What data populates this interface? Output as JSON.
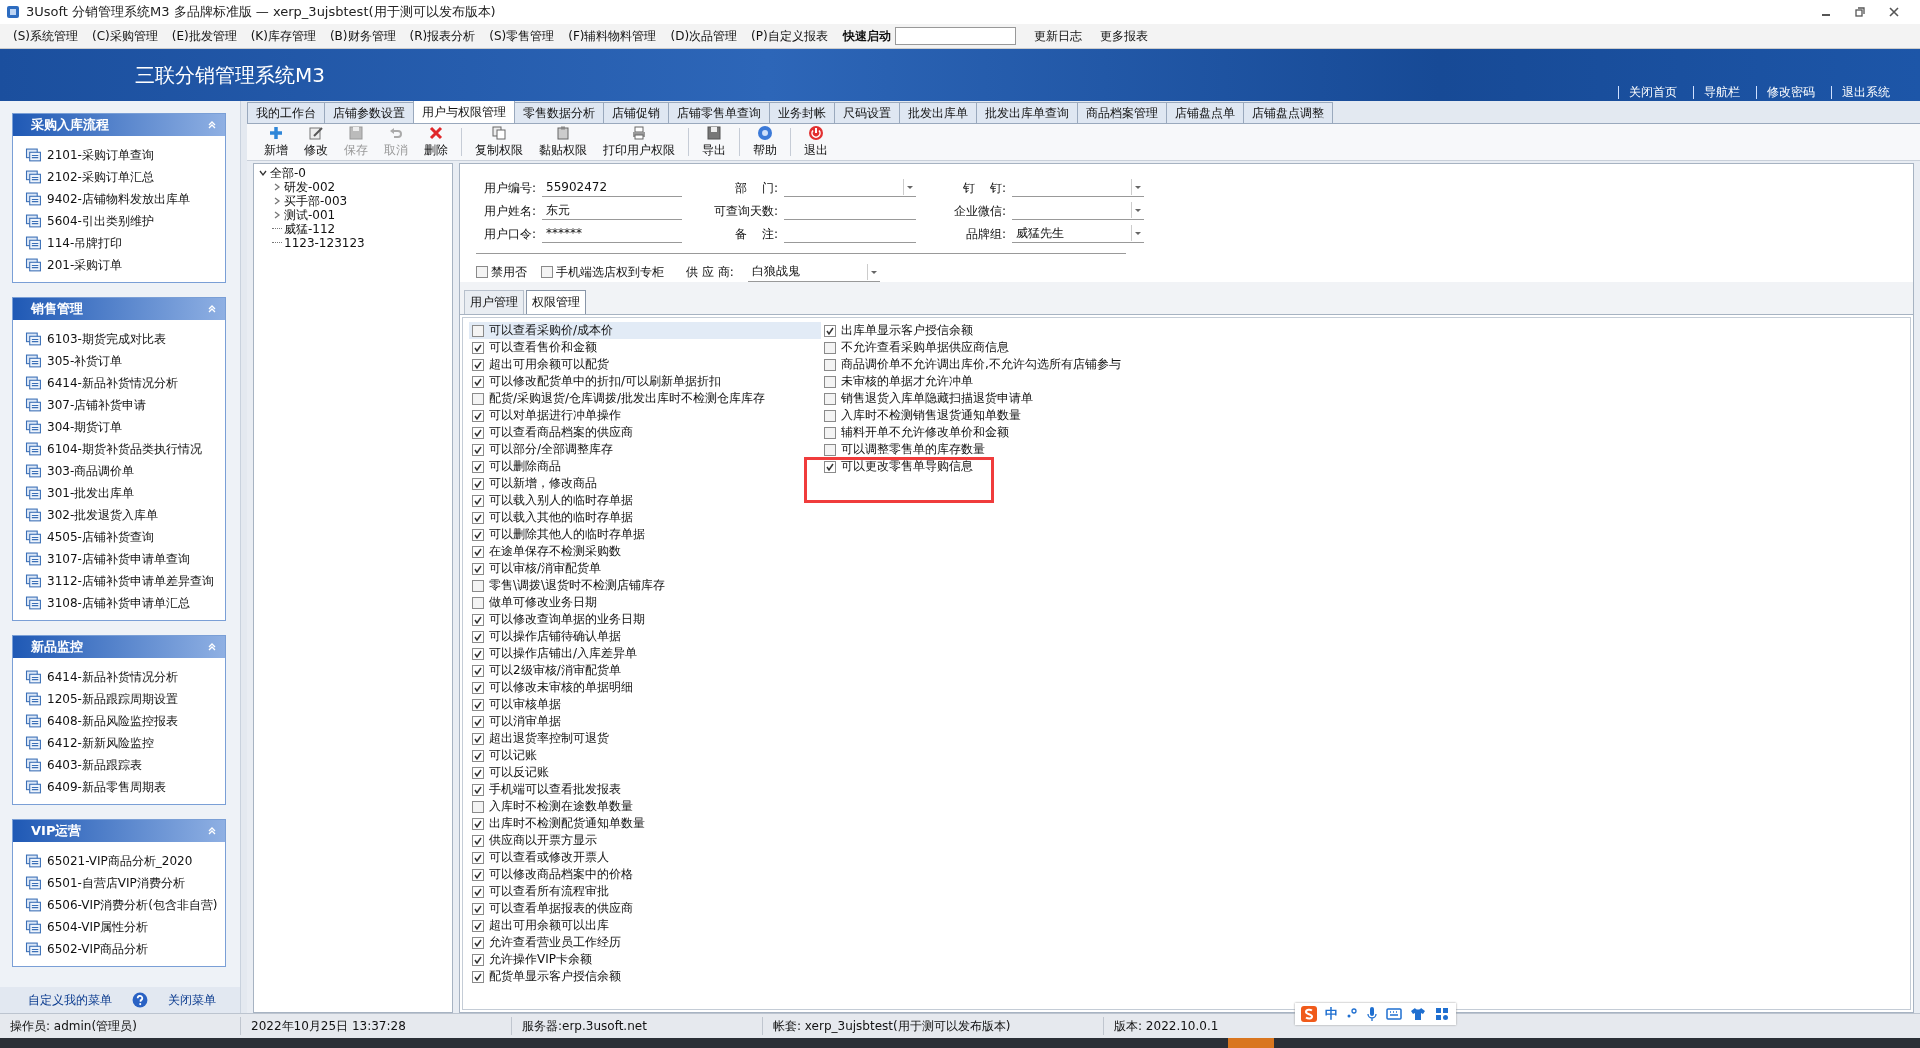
{
  "window": {
    "title": "3Usoft 分销管理系统M3 多品牌标准版 — xerp_3ujsbtest(用于测可以发布版本)"
  },
  "menu_bar": {
    "items": [
      "(S)系统管理",
      "(C)采购管理",
      "(E)批发管理",
      "(K)库存管理",
      "(B)财务管理",
      "(R)报表分析",
      "(S)零售管理",
      "(F)辅料物料管理",
      "(D)次品管理",
      "(P)自定义报表"
    ],
    "quick_launch": {
      "label": "快速启动"
    },
    "links": [
      "更新日志",
      "更多报表"
    ]
  },
  "banner": {
    "title": "三联分销管理系统M3",
    "links": [
      "关闭首页",
      "导航栏",
      "修改密码",
      "退出系统"
    ]
  },
  "sidebar": {
    "groups": [
      {
        "title": "采购入库流程",
        "expanded": true,
        "items": [
          "2101-采购订单查询",
          "2102-采购订单汇总",
          "9402-店铺物料发放出库单",
          "5604-引出类别维护",
          "114-吊牌打印",
          "201-采购订单"
        ]
      },
      {
        "title": "销售管理",
        "expanded": true,
        "items": [
          "6103-期货完成对比表",
          "305-补货订单",
          "6414-新品补货情况分析",
          "307-店铺补货申请",
          "304-期货订单",
          "6104-期货补货品类执行情况",
          "303-商品调价单",
          "301-批发出库单",
          "302-批发退货入库单",
          "4505-店铺补货查询",
          "3107-店铺补货申请单查询",
          "3112-店铺补货申请单差异查询",
          "3108-店铺补货申请单汇总"
        ]
      },
      {
        "title": "新品监控",
        "expanded": true,
        "items": [
          "6414-新品补货情况分析",
          "1205-新品跟踪周期设置",
          "6408-新品风险监控报表",
          "6412-新新风险监控",
          "6403-新品跟踪表",
          "6409-新品零售周期表"
        ]
      },
      {
        "title": "VIP运营",
        "expanded": true,
        "items": [
          "65021-VIP商品分析_2020",
          "6501-自营店VIP消费分析",
          "6506-VIP消费分析(包含非自营)",
          "6504-VIP属性分析",
          "6502-VIP商品分析"
        ]
      }
    ],
    "footer": {
      "customize": "自定义我的菜单",
      "close": "关闭菜单"
    }
  },
  "tabs": [
    {
      "label": "我的工作台",
      "selected": false
    },
    {
      "label": "店铺参数设置",
      "selected": false
    },
    {
      "label": "用户与权限管理",
      "selected": true
    },
    {
      "label": "零售数据分析",
      "selected": false
    },
    {
      "label": "店铺促销",
      "selected": false
    },
    {
      "label": "店铺零售单查询",
      "selected": false
    },
    {
      "label": "业务封帐",
      "selected": false
    },
    {
      "label": "尺码设置",
      "selected": false
    },
    {
      "label": "批发出库单",
      "selected": false
    },
    {
      "label": "批发出库单查询",
      "selected": false
    },
    {
      "label": "商品档案管理",
      "selected": false
    },
    {
      "label": "店铺盘点单",
      "selected": false
    },
    {
      "label": "店铺盘点调整",
      "selected": false
    }
  ],
  "toolbar": [
    {
      "label": "新增",
      "kind": "add",
      "disabled": false,
      "separator_before": false
    },
    {
      "label": "修改",
      "kind": "edit",
      "disabled": false,
      "separator_before": false
    },
    {
      "label": "保存",
      "kind": "save",
      "disabled": true,
      "separator_before": false
    },
    {
      "label": "取消",
      "kind": "undo",
      "disabled": true,
      "separator_before": false
    },
    {
      "label": "删除",
      "kind": "delete",
      "disabled": false,
      "separator_before": false
    },
    {
      "label": "复制权限",
      "kind": "copy",
      "disabled": false,
      "separator_before": true
    },
    {
      "label": "黏贴权限",
      "kind": "paste",
      "disabled": false,
      "separator_before": false
    },
    {
      "label": "打印用户权限",
      "kind": "print",
      "disabled": false,
      "separator_before": false
    },
    {
      "label": "导出",
      "kind": "export",
      "disabled": false,
      "separator_before": true
    },
    {
      "label": "帮助",
      "kind": "help",
      "disabled": false,
      "separator_before": true
    },
    {
      "label": "退出",
      "kind": "exit",
      "disabled": false,
      "separator_before": true
    }
  ],
  "tree": {
    "label": "全部-0",
    "expanded": true,
    "children": [
      {
        "label": "研发-002",
        "expandable": true
      },
      {
        "label": "买手部-003",
        "expandable": true
      },
      {
        "label": "测试-001",
        "expandable": true
      },
      {
        "label": "威猛-112",
        "expandable": false
      },
      {
        "label": "1123-123123",
        "expandable": false
      }
    ]
  },
  "form": {
    "rows": [
      [
        {
          "label": "用户编号:",
          "kind": "text",
          "value": "55902472"
        },
        {
          "label": "部    门:",
          "kind": "dropdown"
        },
        {
          "label": "钉    钉:",
          "kind": "dropdown"
        }
      ],
      [
        {
          "label": "用户姓名:",
          "kind": "text",
          "value": "东元"
        },
        {
          "label": "可查询天数:",
          "kind": "text"
        },
        {
          "label": "企业微信:",
          "kind": "dropdown"
        }
      ],
      [
        {
          "label": "用户口令:",
          "kind": "text",
          "value": "******"
        },
        {
          "label": "备    注:",
          "kind": "text"
        },
        {
          "label": "品牌组:",
          "kind": "dropdown",
          "value": "威猛先生"
        }
      ]
    ],
    "options": [
      {
        "label": "禁用否",
        "checked": false
      },
      {
        "label": "手机端选店权到专柜",
        "checked": false
      }
    ],
    "supplier": {
      "label": "供 应 商:",
      "value": "白狼战鬼"
    }
  },
  "permissions": {
    "tabs": [
      {
        "label": "用户管理",
        "selected": false
      },
      {
        "label": "权限管理",
        "selected": true
      }
    ],
    "columns": [
      {
        "items": [
          {
            "label": "可以查看采购价/成本价",
            "checked": false,
            "selected": true
          },
          {
            "label": "可以查看售价和金额",
            "checked": true,
            "selected": false
          },
          {
            "label": "超出可用余额可以配货",
            "checked": true,
            "selected": false
          },
          {
            "label": "可以修改配货单中的折扣/可以刷新单据折扣",
            "checked": true,
            "selected": false
          },
          {
            "label": "配货/采购退货/仓库调拨/批发出库时不检测仓库库存",
            "checked": false,
            "selected": false
          },
          {
            "label": "可以对单据进行冲单操作",
            "checked": true,
            "selected": false
          },
          {
            "label": "可以查看商品档案的供应商",
            "checked": true,
            "selected": false
          },
          {
            "label": "可以部分/全部调整库存",
            "checked": true,
            "selected": false
          },
          {
            "label": "可以删除商品",
            "checked": true,
            "selected": false
          },
          {
            "label": "可以新增，修改商品",
            "checked": true,
            "selected": false
          },
          {
            "label": "可以载入别人的临时存单据",
            "checked": true,
            "selected": false
          },
          {
            "label": "可以载入其他的临时存单据",
            "checked": true,
            "selected": false
          },
          {
            "label": "可以删除其他人的临时存单据",
            "checked": true,
            "selected": false
          },
          {
            "label": "在途单保存不检测采购数",
            "checked": true,
            "selected": false
          },
          {
            "label": "可以审核/消审配货单",
            "checked": true,
            "selected": false
          },
          {
            "label": "零售\\调拨\\退货时不检测店铺库存",
            "checked": false,
            "selected": false
          },
          {
            "label": "做单可修改业务日期",
            "checked": false,
            "selected": false
          },
          {
            "label": "可以修改查询单据的业务日期",
            "checked": true,
            "selected": false
          },
          {
            "label": "可以操作店铺待确认单据",
            "checked": true,
            "selected": false
          },
          {
            "label": "可以操作店铺出/入库差异单",
            "checked": true,
            "selected": false
          },
          {
            "label": "可以2级审核/消审配货单",
            "checked": true,
            "selected": false
          },
          {
            "label": "可以修改未审核的单据明细",
            "checked": true,
            "selected": false
          },
          {
            "label": "可以审核单据",
            "checked": true,
            "selected": false
          },
          {
            "label": "可以消审单据",
            "checked": true,
            "selected": false
          },
          {
            "label": "超出退货率控制可退货",
            "checked": true,
            "selected": false
          },
          {
            "label": "可以记账",
            "checked": true,
            "selected": false
          },
          {
            "label": "可以反记账",
            "checked": true,
            "selected": false
          },
          {
            "label": "手机端可以查看批发报表",
            "checked": true,
            "selected": false
          },
          {
            "label": "入库时不检测在途数单数量",
            "checked": false,
            "selected": false
          },
          {
            "label": "出库时不检测配货通知单数量",
            "checked": true,
            "selected": false
          },
          {
            "label": "供应商以开票方显示",
            "checked": true,
            "selected": false
          },
          {
            "label": "可以查看或修改开票人",
            "checked": true,
            "selected": false
          },
          {
            "label": "可以修改商品档案中的价格",
            "checked": true,
            "selected": false
          },
          {
            "label": "可以查看所有流程审批",
            "checked": true,
            "selected": false
          },
          {
            "label": "可以查看单据报表的供应商",
            "checked": true,
            "selected": false
          },
          {
            "label": "超出可用余额可以出库",
            "checked": true,
            "selected": false
          },
          {
            "label": "允许查看营业员工作经历",
            "checked": true,
            "selected": false
          },
          {
            "label": "允许操作VIP卡余额",
            "checked": true,
            "selected": false
          },
          {
            "label": "配货单显示客户授信余额",
            "checked": true,
            "selected": false
          }
        ]
      },
      {
        "items": [
          {
            "label": "出库单显示客户授信余额",
            "checked": true,
            "selected": false
          },
          {
            "label": "不允许查看采购单据供应商信息",
            "checked": false,
            "selected": false
          },
          {
            "label": "商品调价单不允许调出库价,不允许勾选所有店铺参与",
            "checked": false,
            "selected": false
          },
          {
            "label": "未审核的单据才允许冲单",
            "checked": false,
            "selected": false
          },
          {
            "label": "销售退货入库单隐藏扫描退货申请单",
            "checked": false,
            "selected": false
          },
          {
            "label": "入库时不检测销售退货通知单数量",
            "checked": false,
            "selected": false
          },
          {
            "label": "辅料开单不允许修改单价和金额",
            "checked": false,
            "selected": false
          },
          {
            "label": "可以调整零售单的库存数量",
            "checked": false,
            "selected": false
          },
          {
            "label": "可以更改零售单导购信息",
            "checked": true,
            "selected": false
          }
        ]
      }
    ]
  },
  "status_bar": [
    "操作员: admin(管理员)",
    "2022年10月25日 13:37:28",
    "服务器:erp.3usoft.net",
    "帐套: xerp_3ujsbtest(用于测可以发布版本)",
    "版本: 2022.10.0.1"
  ],
  "ime": {
    "label": "中"
  }
}
